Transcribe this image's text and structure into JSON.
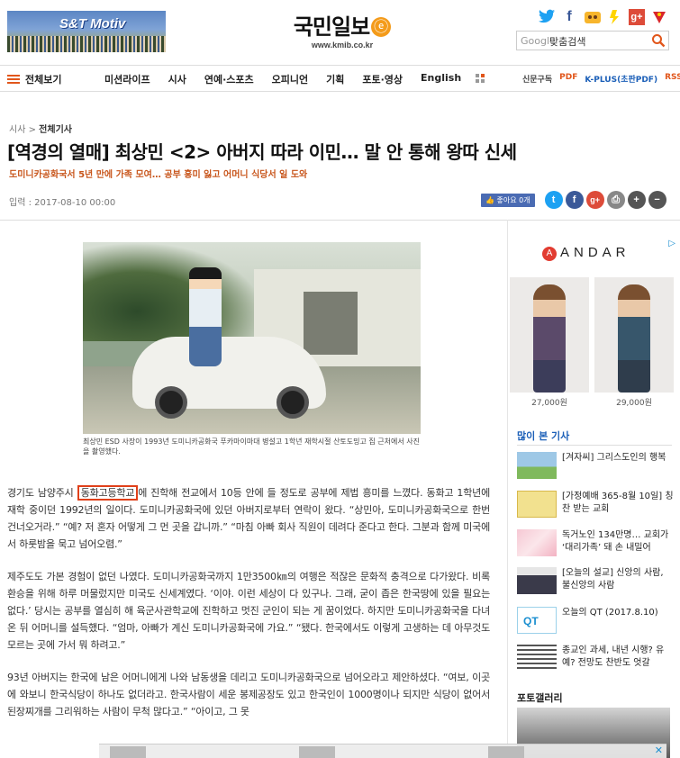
{
  "header": {
    "banner_text": "S&T Motiv",
    "banner_sub": "",
    "logo_name": "국민일보",
    "logo_mark": "ⓔ",
    "logo_url": "www.kmib.co.kr",
    "social_icons": [
      "twitter-icon",
      "facebook-icon",
      "kakaostory-icon",
      "kakao-icon",
      "google-plus-icon",
      "gift-icon"
    ],
    "search_brand": "Google",
    "search_value": "맞춤검색"
  },
  "nav": {
    "all_label": "전체보기",
    "items": [
      "미션라이프",
      "시사",
      "연예·스포츠",
      "오피니언",
      "기획",
      "포토·영상",
      "English"
    ],
    "right": [
      "신문구독",
      "PDF",
      "K-PLUS(초판PDF)",
      "RSS"
    ]
  },
  "article": {
    "breadcrumb_section": "시사",
    "breadcrumb_sep": ">",
    "breadcrumb_sub": "전체기사",
    "title": "[역경의 열매] 최상민 <2> 아버지 따라 이민… 말 안 통해 왕따 신세",
    "subtitle": "도미니카공화국서 5년 만에 가족 모여… 공부 흥미 잃고 어머니 식당서 일 도와",
    "date": "입력 : 2017-08-10 00:00",
    "like_label": "좋아요 0개",
    "caption": "최상민 ESD 사장이 1993년 도미니카공화국 푸카마이마대 병설고 1학년 재학시절 산토도밍고 집 근처에서 사진을 촬영했다.",
    "p1_pre": "경기도 남양주시 ",
    "p1_hl": "동화고등학교",
    "p1_post": "에 진학해 전교에서 10등 안에 들 정도로 공부에 제법 흥미를 느꼈다. 동화고 1학년에 재학 중이던 1992년의 일이다. 도미니카공화국에 있던 아버지로부터 연락이 왔다. “상민아, 도미니카공화국으로 한번 건너오거라.” “예? 저 혼자 어떻게 그 먼 곳을 갑니까.” “마침 아빠 회사 직원이 데려다 준다고 한다. 그분과 함께 미국에서 하룻밤을 묵고 넘어오렴.”",
    "p2": "제주도도 가본 경험이 없던 나였다. 도미니카공화국까지 1만3500㎞의 여행은 적잖은 문화적 충격으로 다가왔다. 비록 환승을 위해 하루 머물렀지만 미국도 신세계였다. ‘이야. 이런 세상이 다 있구나. 그래, 굳이 좁은 한국땅에 있을 필요는 없다.’ 당시는 공부를 열심히 해 육군사관학교에 진학하고 멋진 군인이 되는 게 꿈이었다. 하지만 도미니카공화국을 다녀온 뒤 어머니를 설득했다. “엄마, 아빠가 계신 도미니카공화국에 가요.” “됐다. 한국에서도 이렇게 고생하는 데 아무것도 모르는 곳에 가서 뭐 하려고.”",
    "p3": "93년 아버지는 한국에 남은 어머니에게 나와 남동생을 데리고 도미니카공화국으로 넘어오라고 제안하셨다. “여보, 이곳에 와보니 한국식당이 하나도 없더라고. 한국사람이 세운 봉제공장도 있고 한국인이 1000명이나 되지만 식당이 없어서 된장찌개를 그리워하는 사람이 무척 많다고.” “아이고, 그 못"
  },
  "sidebar": {
    "ad_brand": "ANDAR",
    "ad_brand_mark": "A",
    "ad_prices": [
      "27,000원",
      "29,000원"
    ],
    "most_viewed_title": "많이 본 기사",
    "most_viewed": [
      "[겨자씨] 그리스도인의 행복",
      "[가정예배 365-8월 10일] 칭찬 받는 교회",
      "독거노인 134만명… 교회가 ‘대리가족’ 돼 손 내밀어",
      "[오늘의 설교] 신앙의 사람, 불신앙의 사람",
      "오늘의 QT (2017.8.10)",
      "종교인 과세, 내년 시행? 유예? 전망도 찬반도 엇갈"
    ],
    "qt_thumb_text": "QT",
    "photo_gallery_title": "포토갤러리"
  },
  "colors": {
    "accent": "#e1561b",
    "link_blue": "#1b5fb8",
    "highlight_box": "#e0401a"
  }
}
